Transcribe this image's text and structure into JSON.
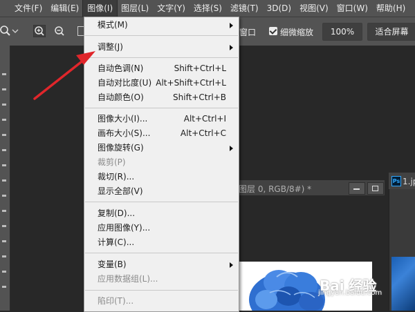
{
  "menubar": {
    "items": [
      "文件(F)",
      "编辑(E)",
      "图像(I)",
      "图层(L)",
      "文字(Y)",
      "选择(S)",
      "滤镜(T)",
      "3D(D)",
      "视图(V)",
      "窗口(W)",
      "帮助(H)"
    ],
    "active_index": 2
  },
  "options_bar": {
    "window_label": "窗口",
    "scrubby_zoom_label": "细微缩放",
    "zoom_value": "100%",
    "fit_screen_label": "适合屏幕"
  },
  "image_menu": {
    "mode": {
      "label": "模式(M)"
    },
    "adjust": {
      "label": "调整(J)"
    },
    "auto_tone": {
      "label": "自动色调(N)",
      "shortcut": "Shift+Ctrl+L"
    },
    "auto_contrast": {
      "label": "自动对比度(U)",
      "shortcut": "Alt+Shift+Ctrl+L"
    },
    "auto_color": {
      "label": "自动颜色(O)",
      "shortcut": "Shift+Ctrl+B"
    },
    "image_size": {
      "label": "图像大小(I)...",
      "shortcut": "Alt+Ctrl+I"
    },
    "canvas_size": {
      "label": "画布大小(S)...",
      "shortcut": "Alt+Ctrl+C"
    },
    "image_rotation": {
      "label": "图像旋转(G)"
    },
    "crop": {
      "label": "裁剪(P)"
    },
    "trim": {
      "label": "裁切(R)..."
    },
    "reveal_all": {
      "label": "显示全部(V)"
    },
    "duplicate": {
      "label": "复制(D)..."
    },
    "apply_image": {
      "label": "应用图像(Y)..."
    },
    "calculations": {
      "label": "计算(C)..."
    },
    "variables": {
      "label": "变量(B)"
    },
    "apply_data_set": {
      "label": "应用数据组(L)..."
    },
    "trap": {
      "label": "陷印(T)..."
    }
  },
  "document": {
    "tab_label": "图层 0, RGB/8#) *",
    "second_tab_badge": "Ps",
    "second_tab_label": "1.jp"
  },
  "watermark": {
    "text": "Bai 经验",
    "subtext": "jingyan.baidu.com"
  },
  "colors": {
    "menubar_bg": "#535353",
    "workspace_bg": "#282828",
    "menu_bg": "#f0f0f0",
    "annotation_arrow": "#e0262b"
  }
}
